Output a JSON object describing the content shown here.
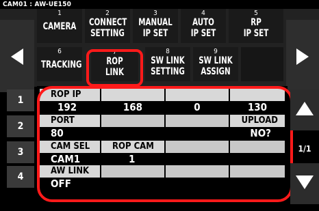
{
  "title": "CAM01 : AW-UE150",
  "menu": {
    "row1": [
      {
        "num": "1",
        "line1": "CAMERA",
        "line2": ""
      },
      {
        "num": "2",
        "line1": "CONNECT",
        "line2": "SETTING"
      },
      {
        "num": "3",
        "line1": "MANUAL",
        "line2": "IP SET"
      },
      {
        "num": "4",
        "line1": "AUTO",
        "line2": "IP SET"
      },
      {
        "num": "5",
        "line1": "RP",
        "line2": "IP SET"
      }
    ],
    "row2": [
      {
        "num": "6",
        "line1": "TRACKING",
        "line2": ""
      },
      {
        "num": "7",
        "line1": "ROP",
        "line2": "LINK"
      },
      {
        "num": "8",
        "line1": "SW LINK",
        "line2": "SETTING"
      },
      {
        "num": "9",
        "line1": "SW LINK",
        "line2": "ASSIGN"
      }
    ]
  },
  "rows": [
    {
      "num": "1",
      "cells": [
        {
          "caption": "ROP IP",
          "value": "192"
        },
        {
          "caption": "",
          "value": "168"
        },
        {
          "caption": "",
          "value": "0"
        },
        {
          "caption": "",
          "value": "130"
        }
      ]
    },
    {
      "num": "2",
      "cells": [
        {
          "caption": "PORT",
          "value": "80"
        },
        {
          "caption": "",
          "value": ""
        },
        {
          "caption": "",
          "value": ""
        },
        {
          "caption": "UPLOAD",
          "value": "NO?"
        }
      ]
    },
    {
      "num": "3",
      "cells": [
        {
          "caption": "CAM SEL",
          "value": "CAM1"
        },
        {
          "caption": "ROP CAM",
          "value": "1"
        },
        {
          "caption": "",
          "value": ""
        },
        {
          "caption": "",
          "value": ""
        }
      ]
    },
    {
      "num": "4",
      "cells": [
        {
          "caption": "AW LINK",
          "value": "OFF"
        },
        {
          "caption": "",
          "value": ""
        },
        {
          "caption": "",
          "value": ""
        },
        {
          "caption": "",
          "value": ""
        }
      ]
    }
  ],
  "page_indicator": "1/1",
  "icons": {
    "prev": "triangle-left-icon",
    "next": "triangle-right-icon",
    "up": "triangle-up-icon",
    "down": "triangle-down-icon"
  },
  "colors": {
    "highlight": "#ff1a1a"
  }
}
